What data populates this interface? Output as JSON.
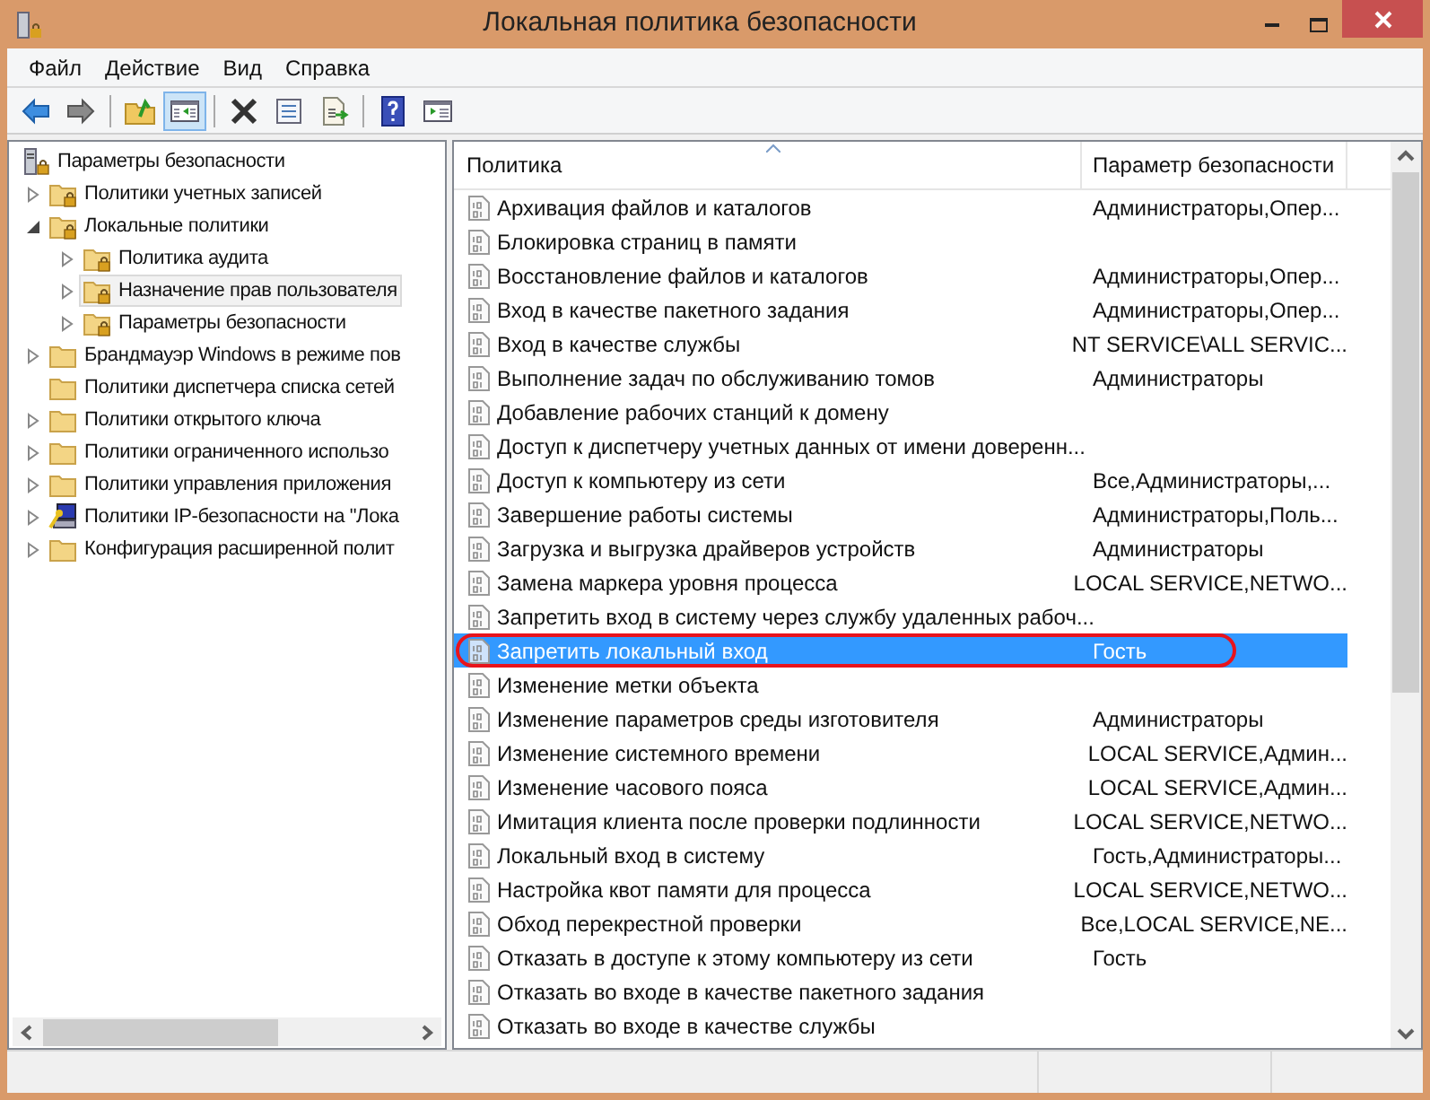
{
  "window": {
    "title": "Локальная политика безопасности"
  },
  "menu": [
    "Файл",
    "Действие",
    "Вид",
    "Справка"
  ],
  "toolbar": [
    {
      "kind": "back",
      "pressed": false
    },
    {
      "kind": "forward",
      "pressed": false
    },
    {
      "kind": "separator"
    },
    {
      "kind": "up",
      "pressed": false
    },
    {
      "kind": "tree",
      "pressed": true
    },
    {
      "kind": "separator"
    },
    {
      "kind": "delete",
      "pressed": false
    },
    {
      "kind": "properties",
      "pressed": false
    },
    {
      "kind": "export",
      "pressed": false
    },
    {
      "kind": "separator"
    },
    {
      "kind": "help",
      "pressed": false
    },
    {
      "kind": "actions",
      "pressed": false
    }
  ],
  "tree": [
    {
      "label": "Параметры безопасности",
      "kind": "security",
      "selected": false,
      "children": [
        {
          "label": "Политики учетных записей",
          "kind": "lockfolder",
          "expanded": false,
          "selected": false
        },
        {
          "label": "Локальные политики",
          "kind": "lockfolder",
          "expanded": true,
          "selected": false,
          "children": [
            {
              "label": "Политика аудита",
              "kind": "lockfolder",
              "expanded": false,
              "selected": false
            },
            {
              "label": "Назначение прав пользователя",
              "kind": "lockfolder",
              "expanded": false,
              "selected": true
            },
            {
              "label": "Параметры безопасности",
              "kind": "lockfolder",
              "expanded": false,
              "selected": false
            }
          ]
        },
        {
          "label": "Брандмауэр Windows в режиме пов",
          "kind": "folder",
          "expanded": false,
          "selected": false
        },
        {
          "label": "Политики диспетчера списка сетей",
          "kind": "folder",
          "selected": false
        },
        {
          "label": "Политики открытого ключа",
          "kind": "folder",
          "expanded": false,
          "selected": false
        },
        {
          "label": "Политики ограниченного использо",
          "kind": "folder",
          "expanded": false,
          "selected": false
        },
        {
          "label": "Политики управления приложения",
          "kind": "folder",
          "expanded": false,
          "selected": false
        },
        {
          "label": "Политики IP-безопасности на \"Лока",
          "kind": "ipsec",
          "expanded": false,
          "selected": false
        },
        {
          "label": "Конфигурация расширенной полит",
          "kind": "folder",
          "expanded": false,
          "selected": false
        }
      ]
    }
  ],
  "table": {
    "columns": [
      "Политика",
      "Параметр безопасности"
    ],
    "rows": [
      {
        "policy": "Архивация файлов и каталогов",
        "setting": "Администраторы,Опер...",
        "selected": false
      },
      {
        "policy": "Блокировка страниц в памяти",
        "setting": "",
        "selected": false
      },
      {
        "policy": "Восстановление файлов и каталогов",
        "setting": "Администраторы,Опер...",
        "selected": false
      },
      {
        "policy": "Вход в качестве пакетного задания",
        "setting": "Администраторы,Опер...",
        "selected": false
      },
      {
        "policy": "Вход в качестве службы",
        "setting": "NT SERVICE\\ALL SERVIC...",
        "selected": false
      },
      {
        "policy": "Выполнение задач по обслуживанию томов",
        "setting": "Администраторы",
        "selected": false
      },
      {
        "policy": "Добавление рабочих станций к домену",
        "setting": "",
        "selected": false
      },
      {
        "policy": "Доступ к диспетчеру учетных данных от имени доверенн...",
        "setting": "",
        "selected": false
      },
      {
        "policy": "Доступ к компьютеру из сети",
        "setting": "Все,Администраторы,...",
        "selected": false
      },
      {
        "policy": "Завершение работы системы",
        "setting": "Администраторы,Поль...",
        "selected": false
      },
      {
        "policy": "Загрузка и выгрузка драйверов устройств",
        "setting": "Администраторы",
        "selected": false
      },
      {
        "policy": "Замена маркера уровня процесса",
        "setting": "LOCAL SERVICE,NETWO...",
        "selected": false
      },
      {
        "policy": "Запретить вход в систему через службу удаленных рабоч...",
        "setting": "",
        "selected": false
      },
      {
        "policy": "Запретить локальный вход",
        "setting": "Гость",
        "selected": true
      },
      {
        "policy": "Изменение метки объекта",
        "setting": "",
        "selected": false
      },
      {
        "policy": "Изменение параметров среды изготовителя",
        "setting": "Администраторы",
        "selected": false
      },
      {
        "policy": "Изменение системного времени",
        "setting": "LOCAL SERVICE,Админ...",
        "selected": false
      },
      {
        "policy": "Изменение часового пояса",
        "setting": "LOCAL SERVICE,Админ...",
        "selected": false
      },
      {
        "policy": "Имитация клиента после проверки подлинности",
        "setting": "LOCAL SERVICE,NETWO...",
        "selected": false
      },
      {
        "policy": "Локальный вход в систему",
        "setting": "Гость,Администраторы...",
        "selected": false
      },
      {
        "policy": "Настройка квот памяти для процесса",
        "setting": "LOCAL SERVICE,NETWO...",
        "selected": false
      },
      {
        "policy": "Обход перекрестной проверки",
        "setting": "Все,LOCAL SERVICE,NE...",
        "selected": false
      },
      {
        "policy": "Отказать в доступе к этому компьютеру из сети",
        "setting": "Гость",
        "selected": false
      },
      {
        "policy": "Отказать во входе в качестве пакетного задания",
        "setting": "",
        "selected": false
      },
      {
        "policy": "Отказать во входе в качестве службы",
        "setting": "",
        "selected": false
      }
    ]
  }
}
